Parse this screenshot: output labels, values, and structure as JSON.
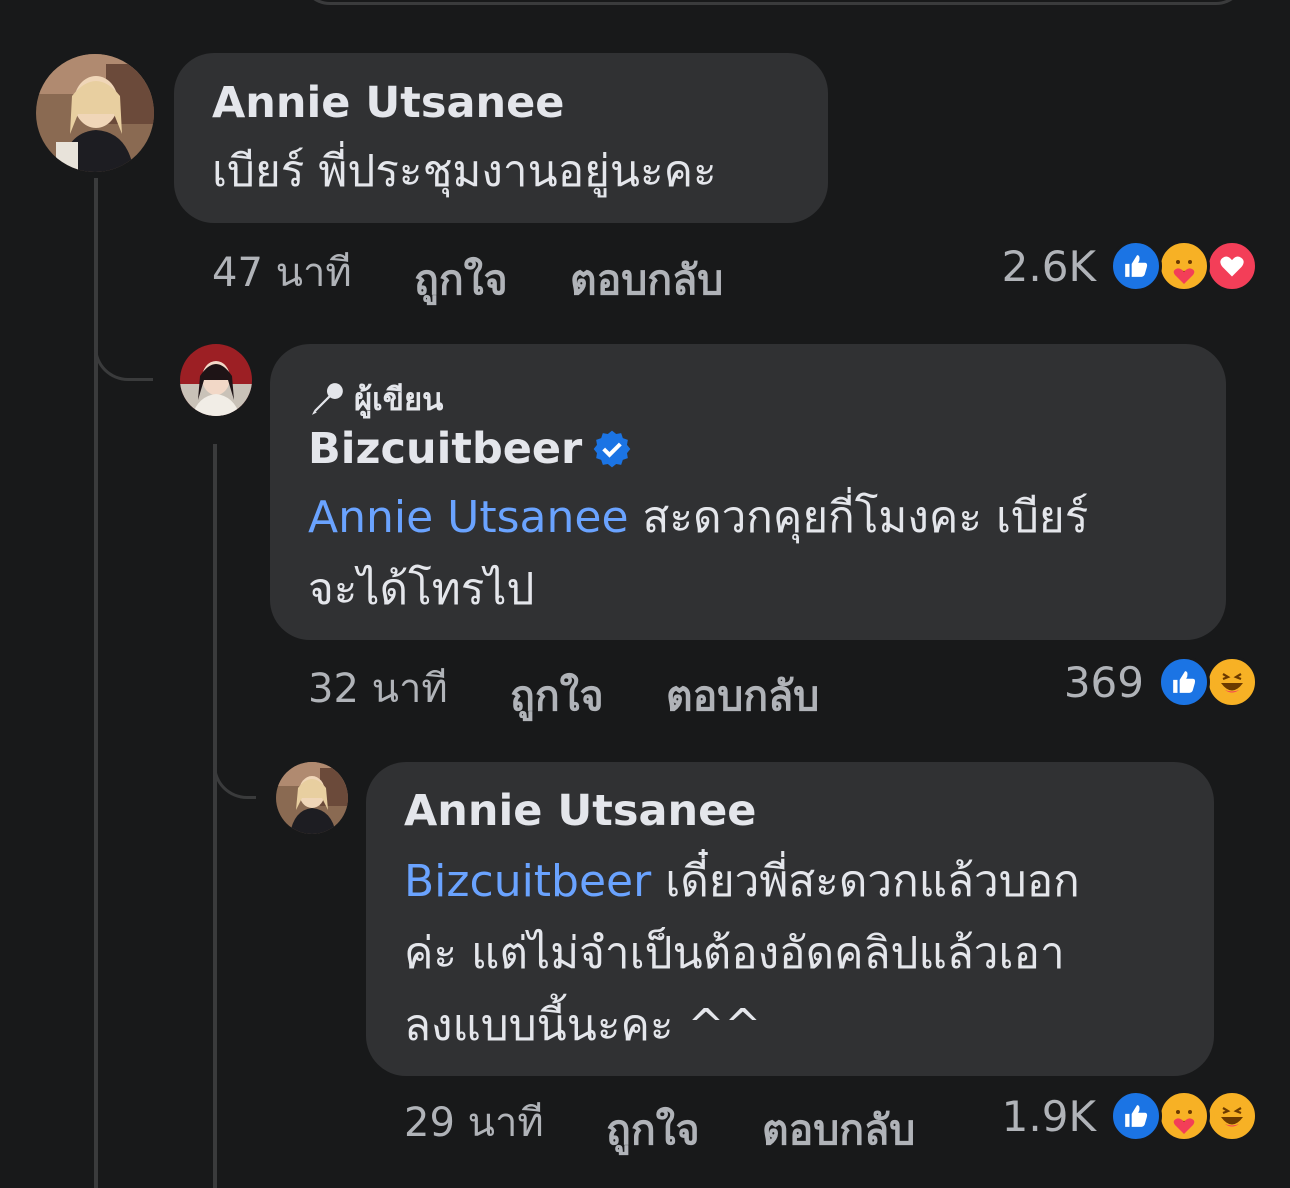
{
  "comment1": {
    "author": "Annie Utsanee",
    "text": "เบียร์ พี่ประชุมงานอยู่นะคะ",
    "time": "47 นาที",
    "like_label": "ถูกใจ",
    "reply_label": "ตอบกลับ",
    "reaction_count": "2.6K",
    "reactions": [
      "like-icon",
      "care-icon",
      "love-icon"
    ]
  },
  "reply1": {
    "badge": "ผู้เขียน",
    "author": "Bizcuitbeer",
    "verified": true,
    "mention": "Annie Utsanee",
    "text_line1": " สะดวกคุยกี่โมงคะ เบียร์",
    "text_line2": "จะได้โทรไป",
    "time": "32 นาที",
    "like_label": "ถูกใจ",
    "reply_label": "ตอบกลับ",
    "reaction_count": "369",
    "reactions": [
      "like-icon",
      "haha-icon"
    ]
  },
  "reply2": {
    "author": "Annie Utsanee",
    "mention": "Bizcuitbeer",
    "text_line1": " เดี๋ยวพี่สะดวกแล้วบอก",
    "text_line2": "ค่ะ แต่ไม่จำเป็นต้องอัดคลิปแล้วเอา",
    "text_line3": "ลงแบบนี้นะคะ ^^",
    "time": "29 นาที",
    "like_label": "ถูกใจ",
    "reply_label": "ตอบกลับ",
    "reaction_count": "1.9K",
    "reactions": [
      "like-icon",
      "care-icon",
      "haha-icon"
    ]
  },
  "colors": {
    "background": "#18191a",
    "bubble": "#303133",
    "mention": "#6aa3ff",
    "like": "#1b74e4",
    "love": "#f33e58",
    "verified": "#1b74e4"
  }
}
